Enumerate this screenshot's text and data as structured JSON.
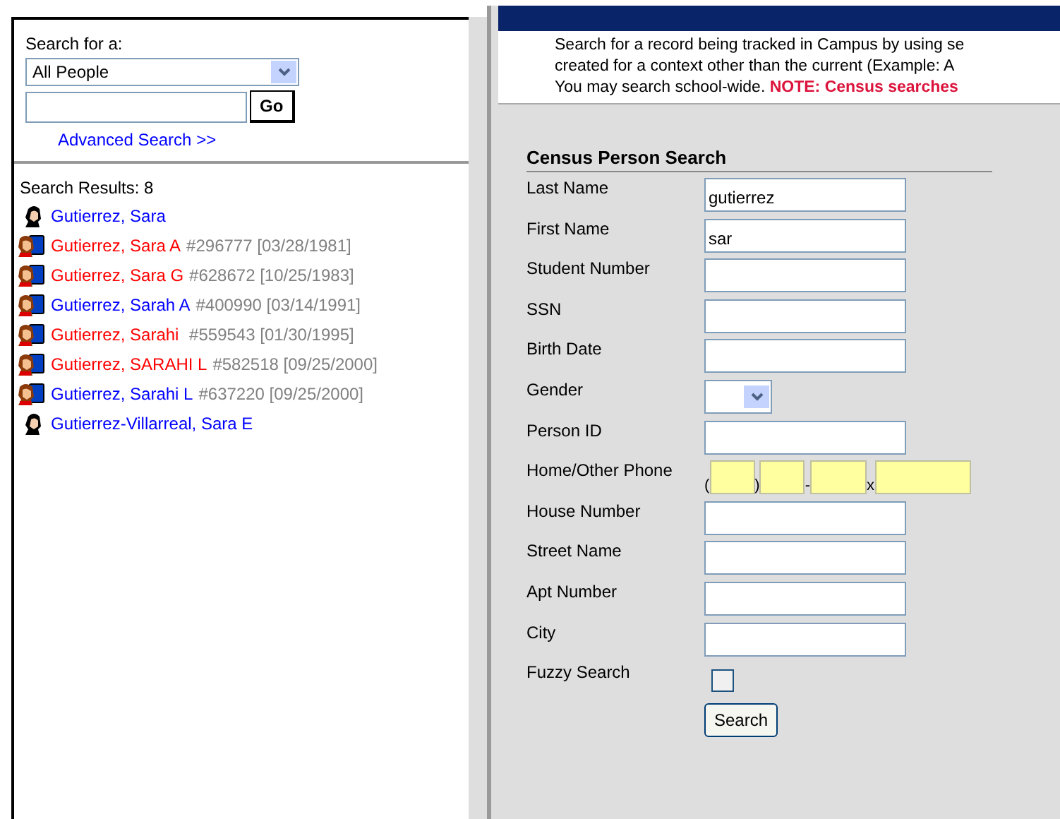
{
  "sidebar": {
    "search_label": "Search for a:",
    "search_type": "All People",
    "go_button": "Go",
    "advanced_link": "Advanced Search >>",
    "results_label": "Search Results: 8",
    "results": [
      {
        "kind": "person",
        "name": "Gutierrez, Sara",
        "color": "#0000ff"
      },
      {
        "kind": "student",
        "name": "Gutierrez, Sara A",
        "id": "#296777",
        "date": "[03/28/1981]",
        "color": "#ff0000"
      },
      {
        "kind": "student",
        "name": "Gutierrez, Sara G",
        "id": "#628672",
        "date": "[10/25/1983]",
        "color": "#ff0000"
      },
      {
        "kind": "student",
        "name": "Gutierrez, Sarah A",
        "id": "#400990",
        "date": "[03/14/1991]",
        "color": "#0000ff"
      },
      {
        "kind": "student",
        "name": "Gutierrez, Sarahi ",
        "id": "#559543",
        "date": "[01/30/1995]",
        "color": "#ff0000"
      },
      {
        "kind": "student",
        "name": "Gutierrez, SARAHI L",
        "id": "#582518",
        "date": "[09/25/2000]",
        "color": "#ff0000"
      },
      {
        "kind": "student",
        "name": "Gutierrez, Sarahi L",
        "id": "#637220",
        "date": "[09/25/2000]",
        "color": "#0000ff"
      },
      {
        "kind": "person",
        "name": "Gutierrez-Villarreal, Sara E",
        "color": "#0000ff"
      }
    ]
  },
  "description": {
    "lines": [
      "Search for a record being tracked in Campus by using se",
      "created for a context other than the current (Example: A",
      "You may search school-wide. **NOTE: Census searches**"
    ]
  },
  "form": {
    "title": "Census Person Search",
    "fields": [
      {
        "kind": "text",
        "label": "Last Name",
        "value": "gutierrez"
      },
      {
        "kind": "text",
        "label": "First Name",
        "value": "sar"
      },
      {
        "kind": "text",
        "label": "Student Number"
      },
      {
        "kind": "text",
        "label": "SSN"
      },
      {
        "kind": "text",
        "label": "Birth Date"
      },
      {
        "kind": "select",
        "label": "Gender"
      },
      {
        "kind": "text",
        "label": "Person ID"
      },
      {
        "kind": "phone",
        "label": "Home/Other Phone",
        "open": "(",
        "close": ")",
        "dash": "-",
        "ext": "x"
      },
      {
        "kind": "text",
        "label": "House Number"
      },
      {
        "kind": "text",
        "label": "Street Name"
      },
      {
        "kind": "text",
        "label": "Apt Number"
      },
      {
        "kind": "text",
        "label": "City"
      },
      {
        "kind": "checkbox",
        "label": "Fuzzy Search",
        "checked": false
      }
    ],
    "search_button": "Search"
  }
}
